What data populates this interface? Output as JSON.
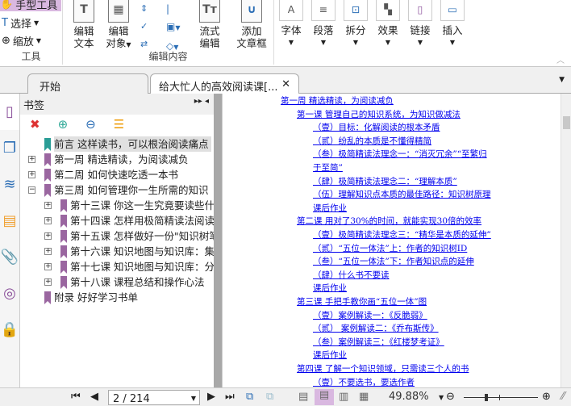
{
  "ribbon": {
    "tools": {
      "hand": "手型工具",
      "select": "选择",
      "zoom": "缩放",
      "label": "工具"
    },
    "edit": {
      "edit_text": [
        "编辑",
        "文本"
      ],
      "edit_object": [
        "编辑",
        "对象"
      ],
      "flow_edit": [
        "流式",
        "编辑"
      ],
      "add_frame": [
        "添加",
        "文章框"
      ],
      "label": "编辑内容"
    },
    "format": [
      "字体",
      "段落",
      "拆分",
      "效果",
      "链接",
      "插入"
    ]
  },
  "tabs": [
    {
      "label": "开始"
    },
    {
      "label": "给大忙人的高效阅读课[..."
    }
  ],
  "bookmarks": {
    "title": "书签",
    "items": [
      {
        "label": "前言 这样读书，可以根治阅读痛点",
        "level": 0,
        "expand": "",
        "selected": true
      },
      {
        "label": "第一周 精选精读，为阅读减负",
        "level": 0,
        "expand": "+"
      },
      {
        "label": "第二周 如何快速吃透一本书",
        "level": 0,
        "expand": "+"
      },
      {
        "label": "第三周 如何管理你一生所需的知识",
        "level": 0,
        "expand": "-"
      },
      {
        "label": "第十三课 你这一生究竟要读些什",
        "level": 1,
        "expand": "+"
      },
      {
        "label": "第十四课 怎样用极简精读法阅读",
        "level": 1,
        "expand": "+"
      },
      {
        "label": "第十五课 怎样做好一份\"知识树笔",
        "level": 1,
        "expand": "+"
      },
      {
        "label": "第十六课 知识地图与知识库：集",
        "level": 1,
        "expand": "+"
      },
      {
        "label": "第十七课 知识地图与知识库：分",
        "level": 1,
        "expand": "+"
      },
      {
        "label": "第十八课 课程总结和操作心法",
        "level": 1,
        "expand": "+"
      },
      {
        "label": "附录 好好学习书单",
        "level": 0,
        "expand": ""
      }
    ]
  },
  "document": {
    "toc": [
      {
        "text": "第一周  精选精读，为阅读减负",
        "indent": 0
      },
      {
        "text": "第一课  管理自己的知识系统，为知识做减法",
        "indent": 1
      },
      {
        "text": "（壹）目标：化解阅读的根本矛盾",
        "indent": 2
      },
      {
        "text": "（贰）纷乱的本质是不懂得精简",
        "indent": 2
      },
      {
        "text": "（叁）极简精读法理念一：“消灭冗余”“至繁归",
        "indent": 2
      },
      {
        "text": "于至简”",
        "indent": 2
      },
      {
        "text": "（肆）极简精读法理念二：“理解本质”",
        "indent": 2
      },
      {
        "text": "（伍）理解知识点本质的最佳路径：知识树原理",
        "indent": 2
      },
      {
        "text": "课后作业",
        "indent": 2
      },
      {
        "text": "第二课  用对了30%的时间，就能实现30倍的效率",
        "indent": 1
      },
      {
        "text": "（壹）极简精读法理念三：“精华是本质的延伸”",
        "indent": 2
      },
      {
        "text": "（贰）“五位一体法”上：作者的知识树ID",
        "indent": 2
      },
      {
        "text": "（叁）“五位一体法”下：作者知识点的延伸",
        "indent": 2
      },
      {
        "text": "（肆）什么书不要读",
        "indent": 2
      },
      {
        "text": "课后作业",
        "indent": 2
      },
      {
        "text": "第三课  手把手教你画“五位一体”图",
        "indent": 1
      },
      {
        "text": "（壹）案例解读一：《反脆弱》",
        "indent": 2
      },
      {
        "text": "（贰）  案例解读二：《乔布斯传》",
        "indent": 2
      },
      {
        "text": "（叁）案例解读三：《红楼梦考证》",
        "indent": 2
      },
      {
        "text": "课后作业",
        "indent": 2
      },
      {
        "text": "第四课  了解一个知识领域，只需读三个人的书",
        "indent": 1
      },
      {
        "text": "（壹）不要选书，要选作者",
        "indent": 2
      }
    ]
  },
  "status": {
    "page": "2 / 214",
    "zoom": "49.88%",
    "zoom_level_fraction": 0.3
  },
  "colors": {
    "link": "#0000ee",
    "bookmark": "#9a66a0",
    "selected_tool": "#d9b8e0"
  }
}
